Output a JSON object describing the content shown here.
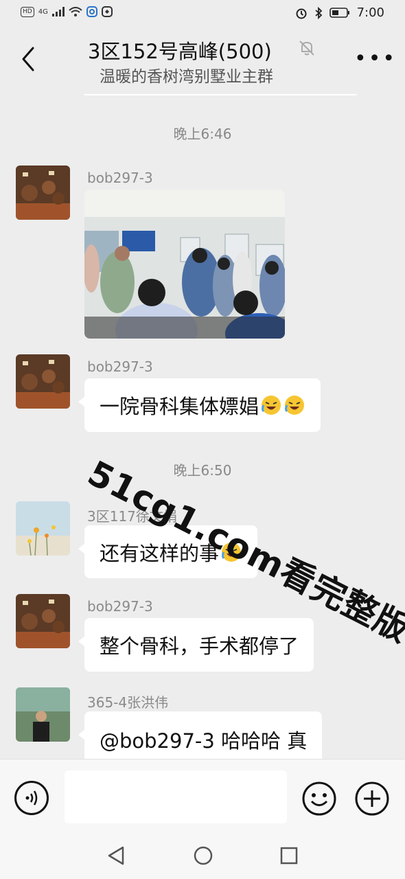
{
  "status_bar": {
    "left_chips": [
      "HD",
      "4G"
    ],
    "left_icons": [
      "signal-icon",
      "wifi-icon",
      "app-notification-icon",
      "app-notification-icon"
    ],
    "right_icons": [
      "alarm-icon",
      "bluetooth-icon",
      "battery-icon"
    ],
    "time": "7:00"
  },
  "header": {
    "title": "3区152号高峰(500)",
    "subtitle": "温暖的香树湾别墅业主群",
    "icons": [
      "back-icon",
      "mute-bell-icon",
      "more-icon"
    ],
    "more_label": "•••"
  },
  "chat": {
    "time_1": "晚上6:46",
    "time_2": "晚上6:50",
    "messages": [
      {
        "sender": "bob297-3",
        "type": "image",
        "avatar": "teapot-avatar"
      },
      {
        "sender": "bob297-3",
        "type": "text",
        "text": "一院骨科集体嫖娼",
        "emoji": [
          "crying-laughing-emoji",
          "crying-laughing-emoji"
        ],
        "avatar": "teapot-avatar"
      },
      {
        "sender": "3区117徐文娟",
        "type": "text",
        "text": "还有这样的事",
        "emoji": [
          "crying-laughing-emoji"
        ],
        "avatar": "flowers-avatar"
      },
      {
        "sender": "bob297-3",
        "type": "text",
        "text": "整个骨科，手术都停了",
        "avatar": "teapot-avatar"
      },
      {
        "sender": "365-4张洪伟",
        "type": "text",
        "text": "@bob297-3  哈哈哈  真",
        "avatar": "person-avatar"
      }
    ],
    "watermark": "51cg1.com看完整版"
  },
  "input_bar": {
    "icons": [
      "voice-icon",
      "emoji-icon",
      "plus-icon"
    ]
  },
  "nav_bar": {
    "icons": [
      "nav-back-icon",
      "nav-home-icon",
      "nav-recents-icon"
    ]
  },
  "colors": {
    "background": "#ededed",
    "bubble": "#ffffff",
    "meta_text": "#888888"
  }
}
